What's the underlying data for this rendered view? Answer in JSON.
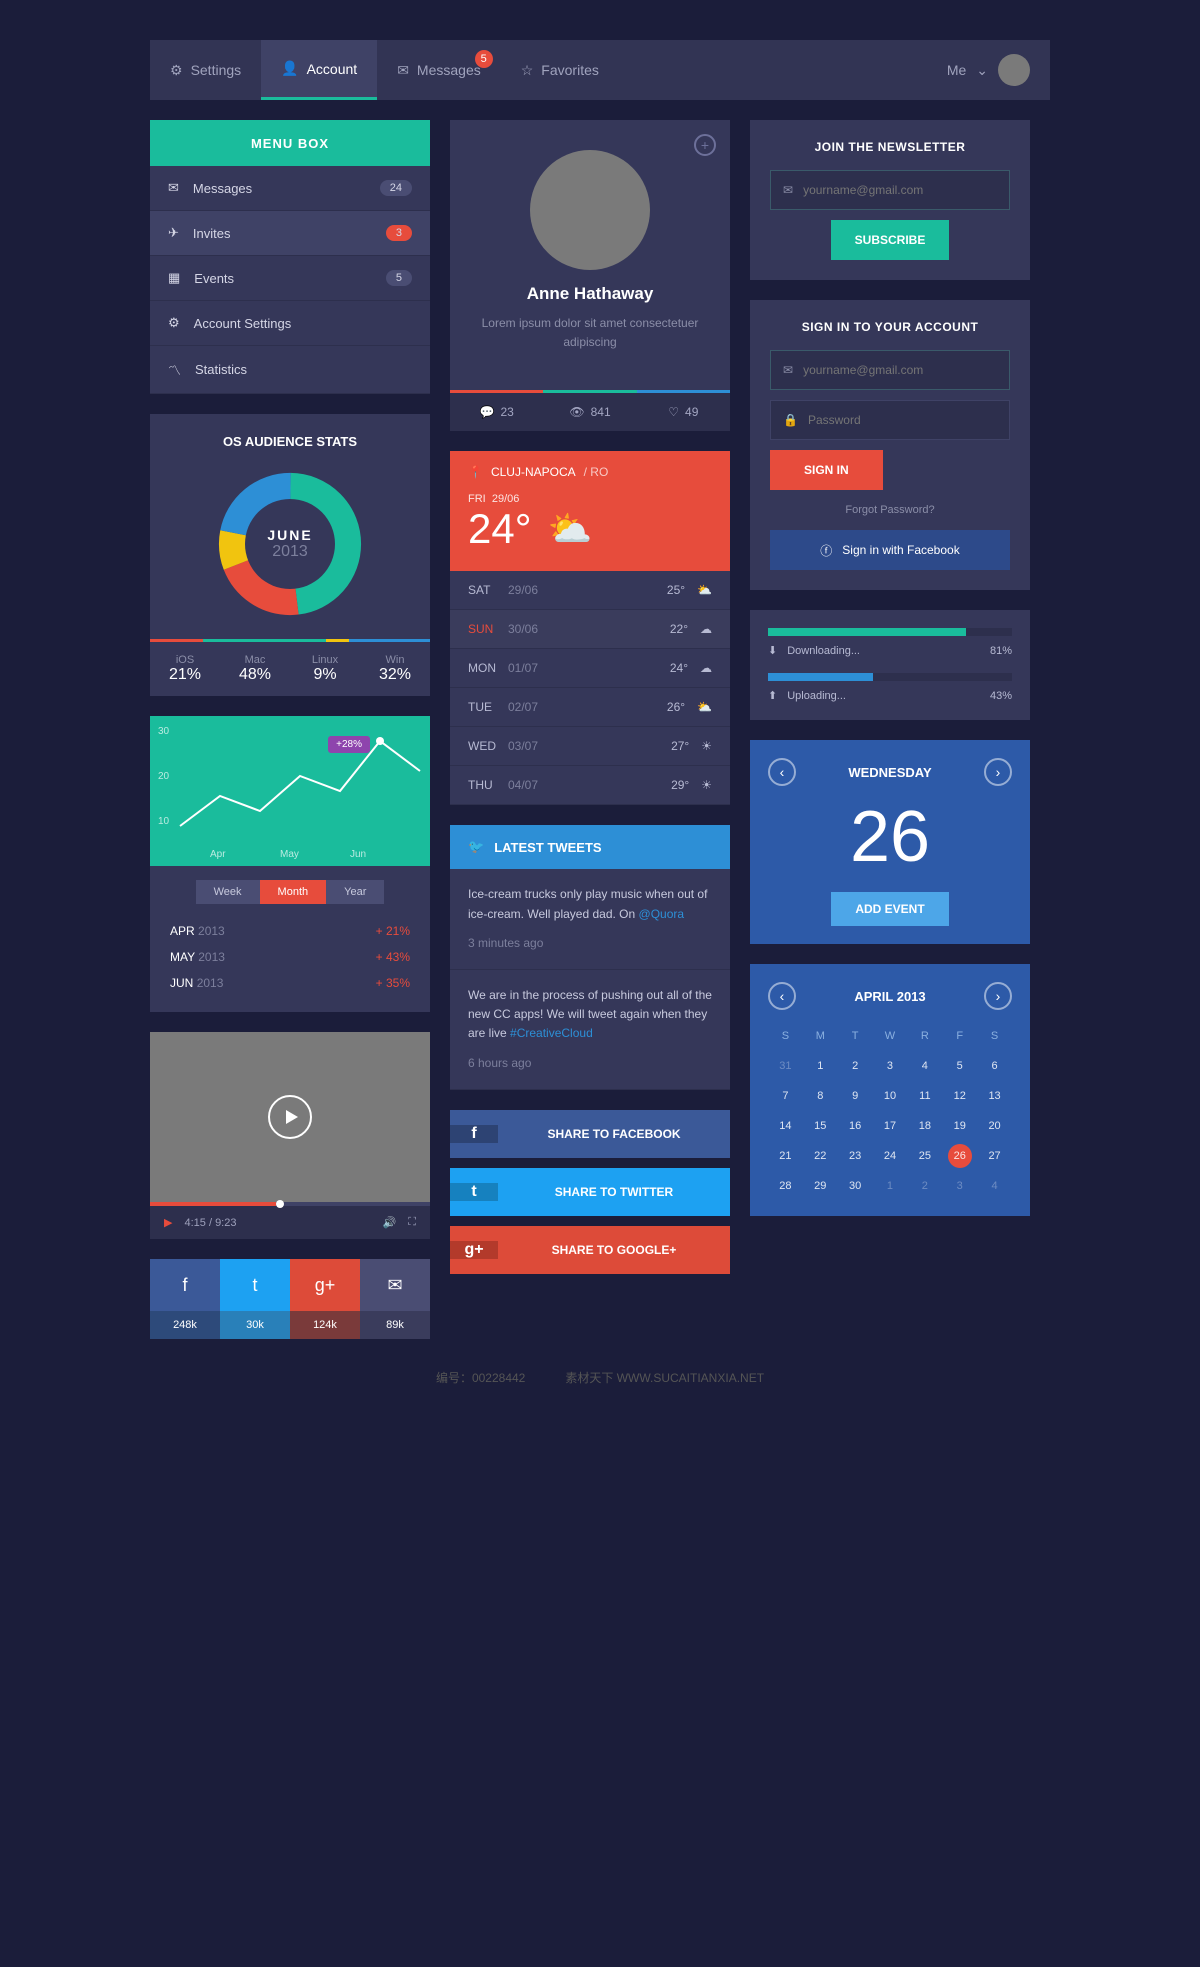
{
  "topnav": {
    "items": [
      {
        "label": "Settings",
        "icon": "gear"
      },
      {
        "label": "Account",
        "icon": "user",
        "active": true
      },
      {
        "label": "Messages",
        "icon": "mail",
        "badge": "5"
      },
      {
        "label": "Favorites",
        "icon": "star"
      }
    ],
    "user_label": "Me"
  },
  "menu": {
    "header": "MENU BOX",
    "items": [
      {
        "label": "Messages",
        "icon": "mail",
        "count": "24"
      },
      {
        "label": "Invites",
        "icon": "send",
        "count": "3",
        "red": true,
        "selected": true
      },
      {
        "label": "Events",
        "icon": "calendar",
        "count": "5"
      },
      {
        "label": "Account Settings",
        "icon": "gear"
      },
      {
        "label": "Statistics",
        "icon": "chart"
      }
    ]
  },
  "stats": {
    "title": "OS AUDIENCE STATS",
    "center_month": "JUNE",
    "center_year": "2013",
    "cells": [
      {
        "label": "iOS",
        "value": "21%"
      },
      {
        "label": "Mac",
        "value": "48%"
      },
      {
        "label": "Linux",
        "value": "9%"
      },
      {
        "label": "Win",
        "value": "32%"
      }
    ]
  },
  "chart_data": {
    "type": "line",
    "x": [
      "Apr",
      "May",
      "Jun"
    ],
    "y_ticks": [
      10,
      20,
      30
    ],
    "xlabel": "",
    "ylabel": "",
    "annotation": "+28%",
    "ylim": [
      0,
      30
    ]
  },
  "chart": {
    "segments": [
      {
        "label": "Week"
      },
      {
        "label": "Month",
        "active": true
      },
      {
        "label": "Year"
      }
    ],
    "rows": [
      {
        "month": "APR",
        "year": "2013",
        "pct": "+ 21%"
      },
      {
        "month": "MAY",
        "year": "2013",
        "pct": "+ 43%"
      },
      {
        "month": "JUN",
        "year": "2013",
        "pct": "+ 35%"
      }
    ]
  },
  "video": {
    "current": "4:15",
    "total": "9:23",
    "progress": 45
  },
  "social": {
    "buttons": [
      "f",
      "t",
      "g+",
      "✉"
    ],
    "counts": [
      "248k",
      "30k",
      "124k",
      "89k"
    ]
  },
  "profile": {
    "name": "Anne Hathaway",
    "desc": "Lorem ipsum dolor sit amet consectetuer adipiscing",
    "stats": [
      {
        "icon": "comment",
        "val": "23"
      },
      {
        "icon": "eye",
        "val": "841"
      },
      {
        "icon": "heart",
        "val": "49"
      }
    ]
  },
  "weather": {
    "city": "CLUJ-NAPOCA",
    "country": "/ RO",
    "today_day": "FRI",
    "today_date": "29/06",
    "today_temp": "24°",
    "rows": [
      {
        "day": "SAT",
        "date": "29/06",
        "temp": "25°",
        "icon": "partly"
      },
      {
        "day": "SUN",
        "date": "30/06",
        "temp": "22°",
        "icon": "cloud",
        "highlight": true
      },
      {
        "day": "MON",
        "date": "01/07",
        "temp": "24°",
        "icon": "cloud"
      },
      {
        "day": "TUE",
        "date": "02/07",
        "temp": "26°",
        "icon": "partly"
      },
      {
        "day": "WED",
        "date": "03/07",
        "temp": "27°",
        "icon": "sun"
      },
      {
        "day": "THU",
        "date": "04/07",
        "temp": "29°",
        "icon": "sun"
      }
    ]
  },
  "tweets": {
    "header": "LATEST TWEETS",
    "items": [
      {
        "text": "Ice-cream trucks only play music when out of ice-cream. Well played dad. On ",
        "link": "@Quora",
        "time": "3 minutes ago"
      },
      {
        "text": "We are in the process of pushing out all of the new CC apps! We will tweet again when they are live ",
        "link": "#CreativeCloud",
        "time": "6 hours ago"
      }
    ]
  },
  "share": [
    {
      "label": "SHARE TO FACEBOOK",
      "cls": "fb",
      "icon": "f"
    },
    {
      "label": "SHARE TO TWITTER",
      "cls": "tw",
      "icon": "t"
    },
    {
      "label": "SHARE TO GOOGLE+",
      "cls": "gp",
      "icon": "g+"
    }
  ],
  "newsletter": {
    "title": "JOIN THE NEWSLETTER",
    "placeholder": "yourname@gmail.com",
    "button": "SUBSCRIBE"
  },
  "signin": {
    "title": "SIGN IN TO YOUR ACCOUNT",
    "email_placeholder": "yourname@gmail.com",
    "password_placeholder": "Password",
    "button": "SIGN IN",
    "forgot": "Forgot Password?",
    "facebook": "Sign in with Facebook"
  },
  "progress": {
    "items": [
      {
        "label": "Downloading...",
        "pct": "81%",
        "val": 81,
        "color": "#1abc9c"
      },
      {
        "label": "Uploading...",
        "pct": "43%",
        "val": 43,
        "color": "#2d8fd6"
      }
    ]
  },
  "event": {
    "day_name": "WEDNESDAY",
    "day_num": "26",
    "button": "ADD EVENT"
  },
  "calendar": {
    "title": "APRIL 2013",
    "headers": [
      "S",
      "M",
      "T",
      "W",
      "R",
      "F",
      "S"
    ],
    "leading_dim": [
      31
    ],
    "days": 30,
    "today": 26,
    "trailing_dim": [
      1,
      2,
      3,
      4
    ]
  },
  "footer": {
    "left": "编号：00228442",
    "right": "素材天下 WWW.SUCAITIANXIA.NET"
  }
}
